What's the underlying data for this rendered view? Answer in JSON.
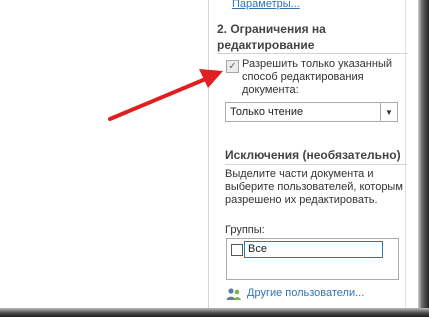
{
  "top_link": "Параметры...",
  "section2": {
    "title": "2. Ограничения на редактирование",
    "checkbox_label": "Разрешить только указанный способ редактирования документа:",
    "checkbox_checked": true,
    "mode_select": "Только чтение"
  },
  "exceptions": {
    "title": "Исключения (необязательно)",
    "description": "Выделите части документа и выберите пользователей, которым разрешено их редактировать.",
    "groups_label": "Группы:",
    "groups": [
      {
        "label": "Все",
        "checked": false
      }
    ],
    "other_users_link": "Другие пользователи..."
  },
  "annotation": {
    "arrow_color": "#e02020"
  },
  "colors": {
    "link": "#2e75b6"
  }
}
